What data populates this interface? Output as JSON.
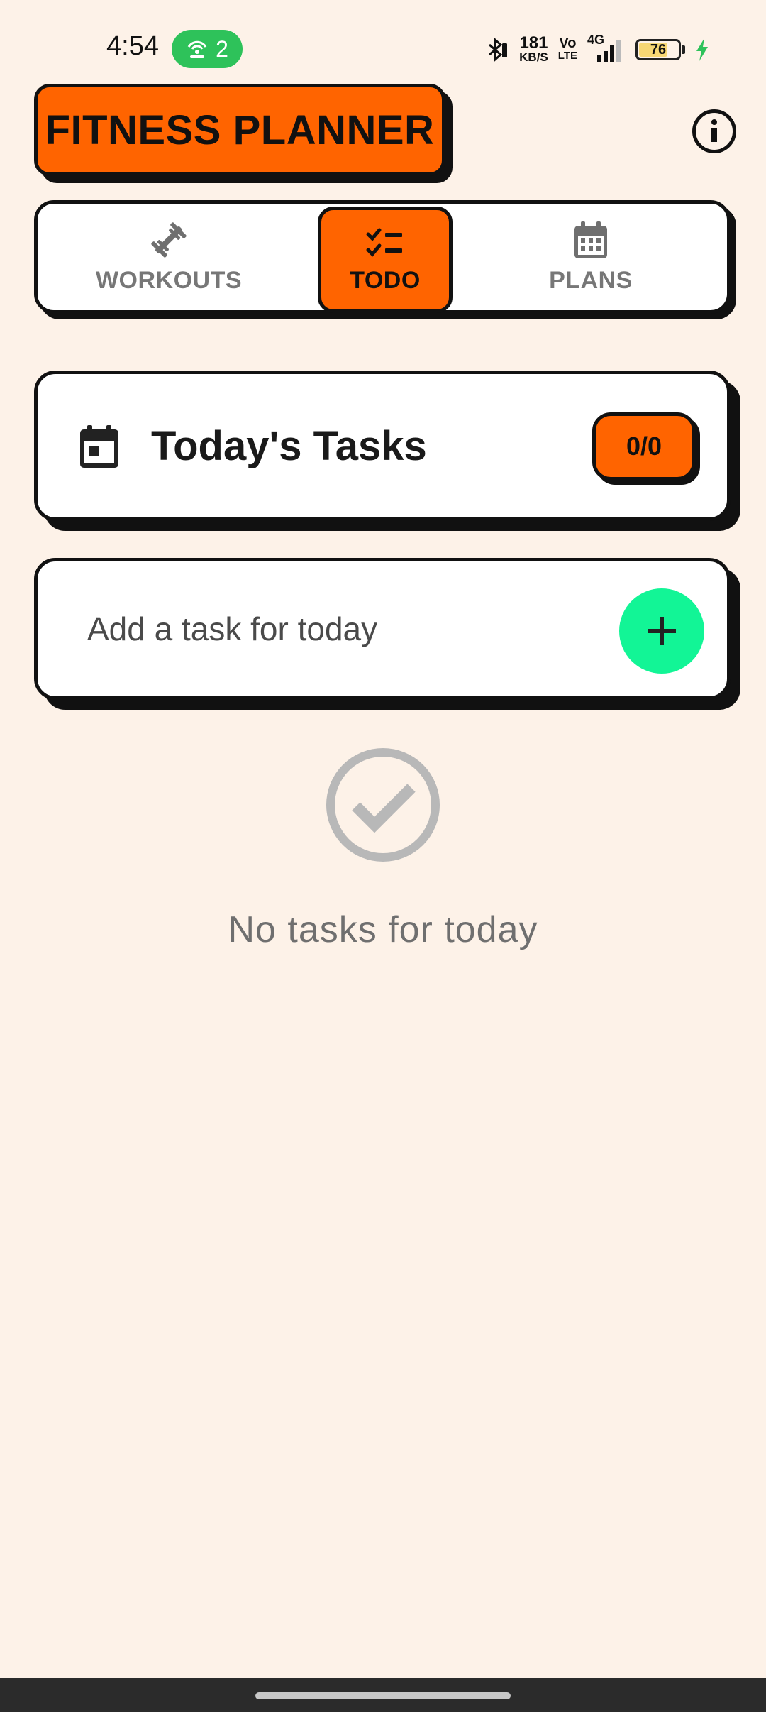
{
  "status_bar": {
    "time": "4:54",
    "hotspot_count": "2",
    "net_speed_value": "181",
    "net_speed_unit": "KB/S",
    "volte_top": "Vo",
    "volte_bottom": "LTE",
    "network": "4G",
    "battery_level": "76",
    "battery_fraction": 0.76,
    "icons": [
      "hotspot-icon",
      "bluetooth-icon",
      "signal-icon",
      "battery-icon",
      "charging-icon"
    ]
  },
  "header": {
    "title": "FITNESS PLANNER",
    "info_icon": "info-icon"
  },
  "tabs": [
    {
      "label": "WORKOUTS",
      "icon": "dumbbell-icon",
      "active": false
    },
    {
      "label": "TODO",
      "icon": "checklist-icon",
      "active": true
    },
    {
      "label": "PLANS",
      "icon": "calendar-icon",
      "active": false
    }
  ],
  "today": {
    "title": "Today's Tasks",
    "count": "0/0",
    "icon": "calendar-icon"
  },
  "add_task": {
    "placeholder": "Add a task for today",
    "value": "",
    "button_icon": "plus-icon"
  },
  "empty_state": {
    "icon": "check-circle-icon",
    "message": "No tasks for today"
  },
  "colors": {
    "background": "#fdf2e8",
    "accent": "#ff6400",
    "add_button": "#12f596",
    "border": "#111111"
  }
}
